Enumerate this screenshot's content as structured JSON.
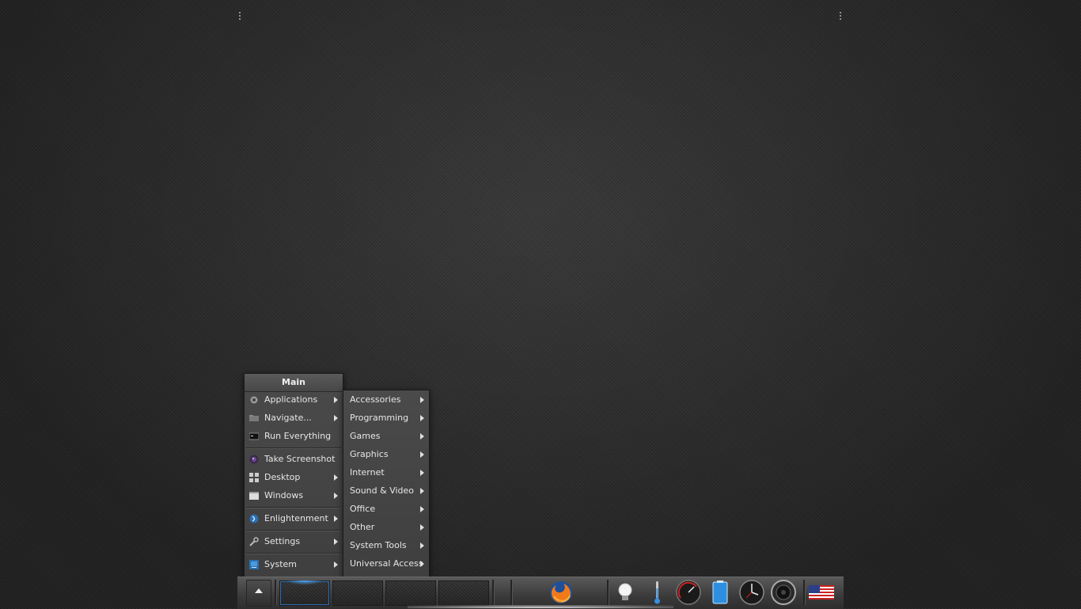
{
  "main_menu": {
    "title": "Main",
    "items": [
      {
        "label": "Applications",
        "icon": "gear-icon",
        "submenu": true
      },
      {
        "label": "Navigate...",
        "icon": "folder-icon",
        "submenu": true
      },
      {
        "label": "Run Everything",
        "icon": "terminal-icon",
        "submenu": false
      },
      {
        "label": "Take Screenshot",
        "icon": "camera-icon",
        "submenu": false
      },
      {
        "label": "Desktop",
        "icon": "grid-icon",
        "submenu": true
      },
      {
        "label": "Windows",
        "icon": "window-icon",
        "submenu": true
      },
      {
        "label": "Enlightenment",
        "icon": "enlightenment-logo-icon",
        "submenu": true
      },
      {
        "label": "Settings",
        "icon": "wrench-icon",
        "submenu": true
      },
      {
        "label": "System",
        "icon": "monitor-icon",
        "submenu": true
      }
    ]
  },
  "applications_menu": {
    "items": [
      {
        "label": "Accessories"
      },
      {
        "label": "Programming"
      },
      {
        "label": "Games"
      },
      {
        "label": "Graphics"
      },
      {
        "label": "Internet"
      },
      {
        "label": "Sound & Video"
      },
      {
        "label": "Office"
      },
      {
        "label": "Other"
      },
      {
        "label": "System Tools"
      },
      {
        "label": "Universal Access"
      }
    ]
  },
  "shelf": {
    "start_icon": "chevron-up-icon",
    "virtual_desktops": 4,
    "active_desktop": 1,
    "launchers": [
      "firefox-icon"
    ],
    "gadgets": [
      "lightbulb-icon",
      "thermometer-icon",
      "cpu-gauge-icon",
      "battery-icon",
      "clock-icon",
      "speaker-icon",
      "us-flag-icon"
    ]
  },
  "colors": {
    "accent": "#2a6fb0",
    "menu_bg": "#444444",
    "desktop_bg": "#2f2f2f"
  }
}
